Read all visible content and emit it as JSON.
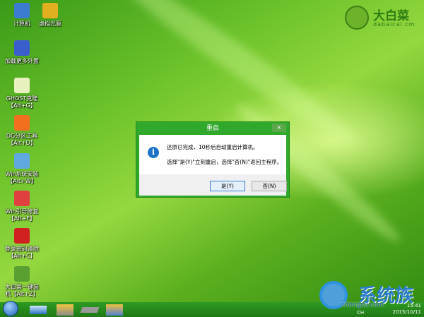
{
  "desktop": {
    "icons": [
      {
        "label": "计算机",
        "icon": "computer-icon"
      },
      {
        "label": "虚拟光驱",
        "icon": "virtual-drive-icon"
      },
      {
        "label": "加载更多外置",
        "icon": "load-more-icon"
      },
      {
        "label": "GHOST克隆\n【Alt+G】",
        "icon": "ghost-icon"
      },
      {
        "label": "DG分区工具\n【Alt+D】",
        "icon": "diskgenius-icon"
      },
      {
        "label": "Win系统安装\n【Alt+W】",
        "icon": "win-install-icon"
      },
      {
        "label": "Win引导修复\n【Alt+F】",
        "icon": "boot-repair-icon"
      },
      {
        "label": "登录密码清除\n【Alt+C】",
        "icon": "password-clear-icon"
      },
      {
        "label": "大白菜一键装\n机【Alt+Z】",
        "icon": "dabaicai-install-icon"
      }
    ]
  },
  "logo": {
    "name": "大白菜",
    "url": "dabaicai.cm"
  },
  "dialog": {
    "title": "重启",
    "close": "×",
    "message1": "还原已完成，10秒后自动重启计算机。",
    "message2": "选择\"是(Y)\"立刻重启，选择\"否(N)\"返回主程序。",
    "yes": "是(Y)",
    "no": "否(N)"
  },
  "taskbar": {
    "lang": "CH",
    "time": "15:41",
    "date": "2015/10/11"
  },
  "watermark": {
    "text": "系统族",
    "url": "xitongzu.com"
  }
}
